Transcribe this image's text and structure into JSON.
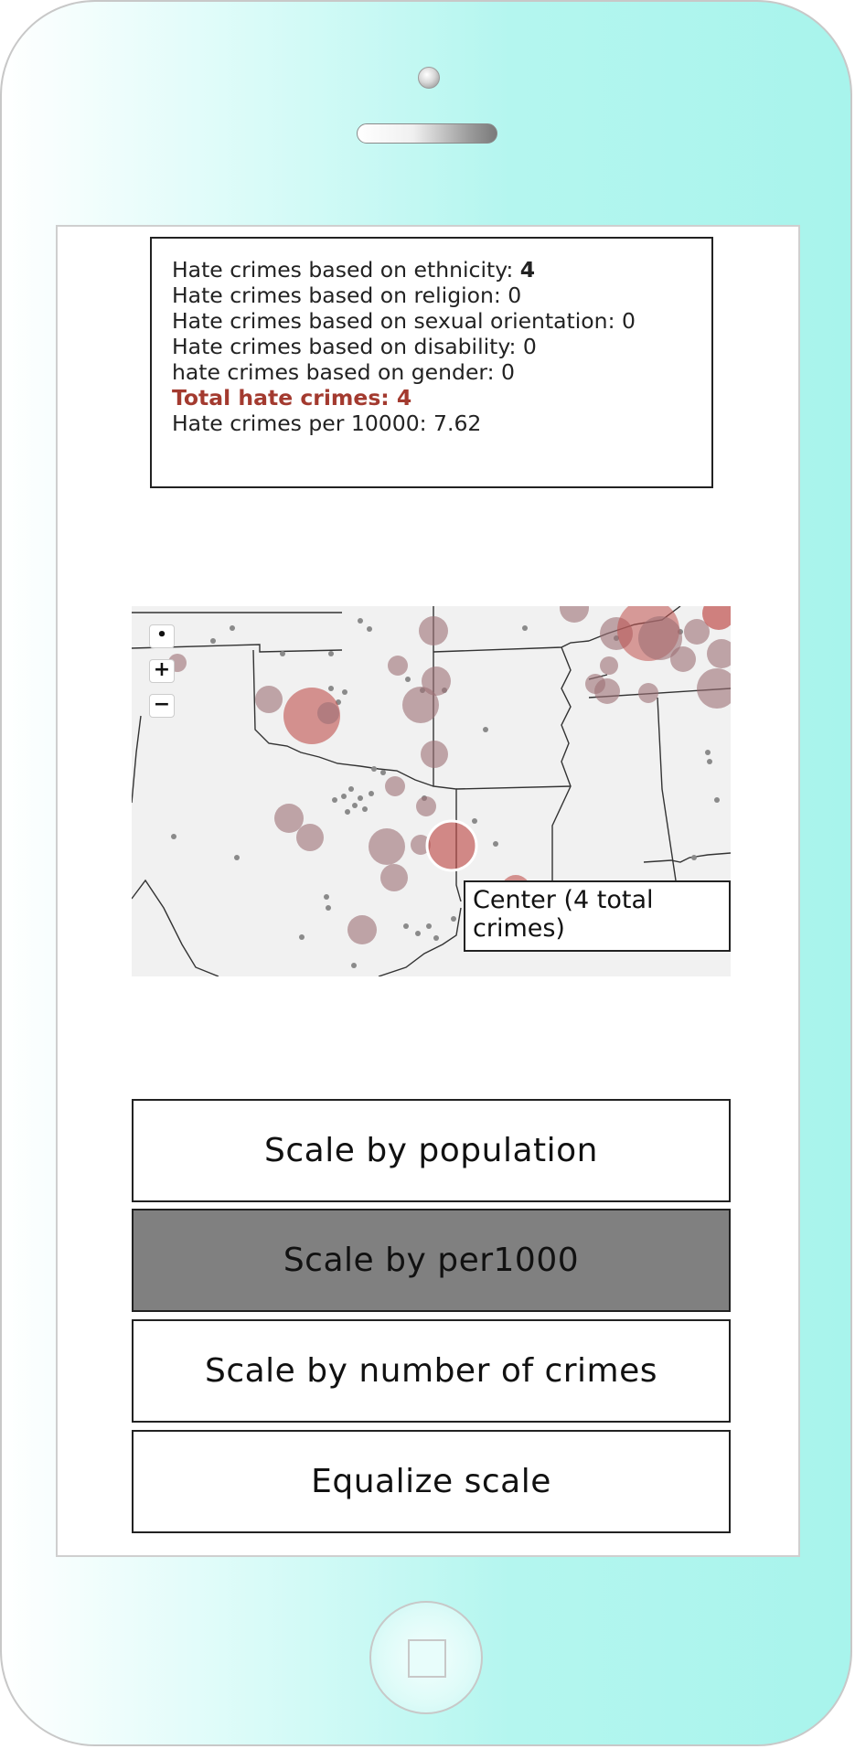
{
  "info": {
    "ethnicity_label": "Hate crimes based on ethnicity: ",
    "ethnicity_value": "4",
    "religion": "Hate crimes based on religion: 0",
    "sexual_orientation": "Hate crimes based on sexual orientation: 0",
    "disability": "Hate crimes based on disability: 0",
    "gender": "hate crimes based on gender: 0",
    "total": "Total hate crimes: 4",
    "per10000": "Hate crimes per 10000: 7.62"
  },
  "map": {
    "controls": {
      "locate": "•",
      "zoom_in": "+",
      "zoom_out": "−"
    },
    "tooltip": "Center (4 total crimes)",
    "colors": {
      "land": "#f1f1f1",
      "border": "#333333",
      "dot": "#8a8a8a",
      "bubble": "#9c6f75",
      "bubble_highlight": "#c0504d"
    }
  },
  "buttons": [
    {
      "label": "Scale by population",
      "active": false
    },
    {
      "label": "Scale by per1000",
      "active": true
    },
    {
      "label": "Scale by number of crimes",
      "active": false
    },
    {
      "label": "Equalize scale",
      "active": false
    }
  ]
}
